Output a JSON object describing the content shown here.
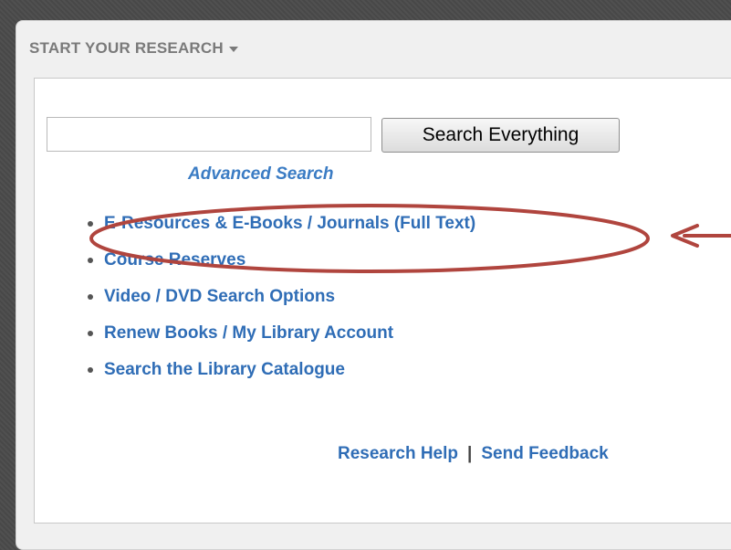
{
  "panel": {
    "header_label": "START YOUR RESEARCH"
  },
  "search": {
    "input_value": "",
    "button_label": "Search Everything",
    "advanced_label": "Advanced Search"
  },
  "links": [
    {
      "label": "E-Resources & E-Books / Journals (Full Text)"
    },
    {
      "label": "Course Reserves"
    },
    {
      "label": "Video / DVD Search Options"
    },
    {
      "label": "Renew Books / My Library Account"
    },
    {
      "label": "Search the Library Catalogue"
    }
  ],
  "footer": {
    "help_label": "Research Help",
    "separator": "|",
    "feedback_label": "Send Feedback"
  },
  "annotation": {
    "highlight_color": "#b0453e",
    "icon": "arrow-left-icon"
  }
}
